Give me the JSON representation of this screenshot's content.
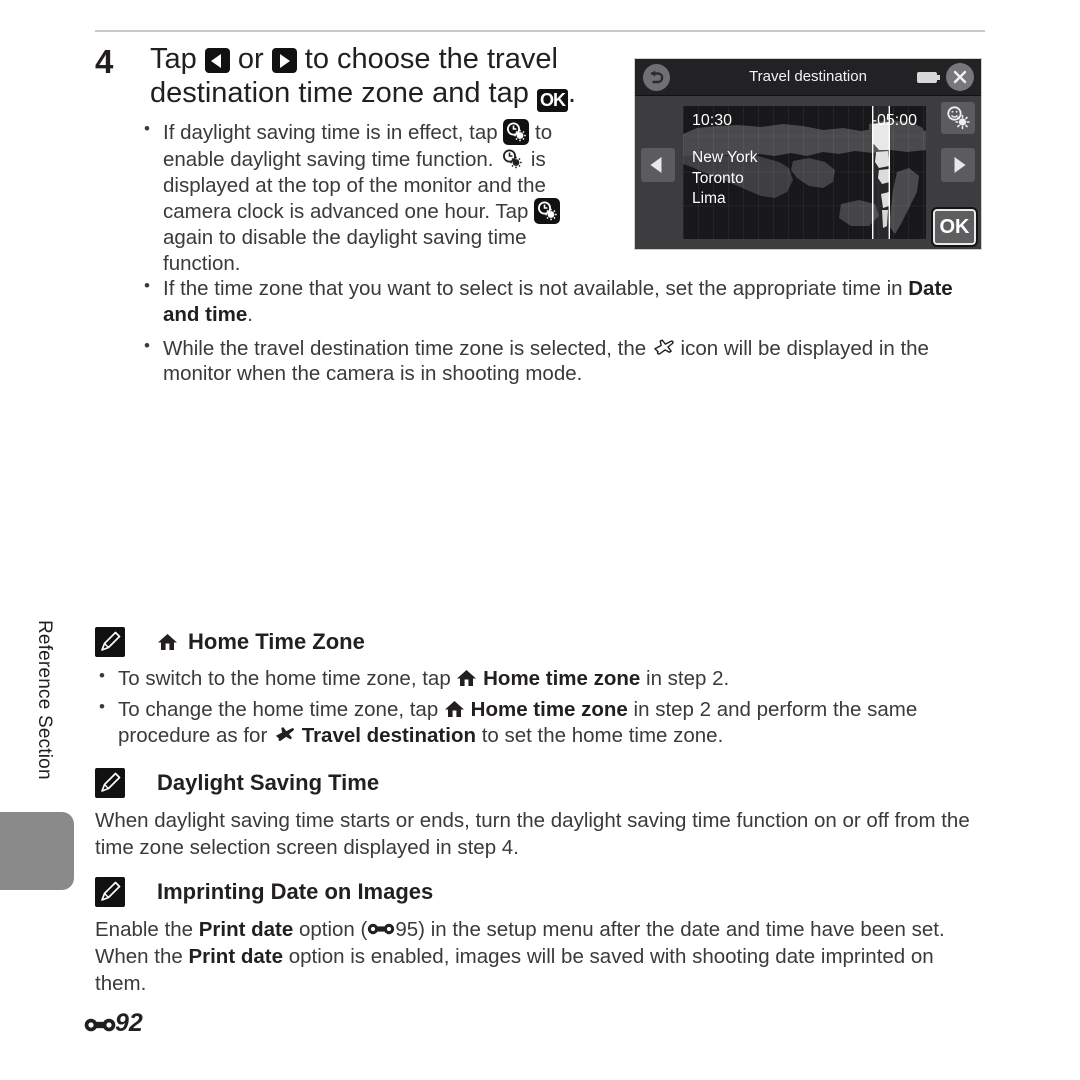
{
  "page": {
    "footer_marker_icon": "dumbbell-reference-icon",
    "footer_page_number": "92",
    "side_tab_label": "Reference Section"
  },
  "step": {
    "number": "4",
    "heading_part1": "Tap ",
    "heading_icon_left": "left-triangle-icon",
    "heading_or": " or ",
    "heading_icon_right": "right-triangle-icon",
    "heading_part2": " to choose the travel destination time zone and tap ",
    "heading_ok": "OK",
    "heading_end": ".",
    "bullets": [
      {
        "t1": "If daylight saving time is in effect, tap ",
        "icon1": "daylight-saving-inverse-icon",
        "t2": " to enable daylight saving time function. ",
        "icon2": "daylight-saving-icon",
        "t3": " is displayed at the top of the monitor and the camera clock is advanced one hour. Tap ",
        "icon3": "daylight-saving-inverse-icon",
        "t4": " again to disable the daylight saving time function."
      },
      {
        "t1": "If the time zone that you want to select is not available, set the appropriate time in ",
        "b1": "Date and time",
        "t2": "."
      },
      {
        "t1": "While the travel destination time zone is selected, the ",
        "icon1": "airplane-icon",
        "t2": " icon will be displayed in the monitor when the camera is in shooting mode."
      }
    ]
  },
  "screen": {
    "back_icon": "back-arrow-icon",
    "title": "Travel destination",
    "battery_icon": "battery-icon",
    "close_icon": "close-x-icon",
    "time": "10:30",
    "utc_offset": "-05:00",
    "cities": [
      "New York",
      "Toronto",
      "Lima"
    ],
    "prev_icon": "left-triangle-icon",
    "next_icon": "right-triangle-icon",
    "dst_icon": "daylight-saving-icon",
    "ok_label": "OK"
  },
  "notes": [
    {
      "id": "home-time-zone",
      "note_icon": "pencil-note-icon",
      "title_icon": "home-icon",
      "title": "Home Time Zone",
      "bullets": [
        {
          "t1": "To switch to the home time zone, tap ",
          "icon1": "home-icon",
          "b1": "Home time zone",
          "t2": " in step 2."
        },
        {
          "t1": "To change the home time zone, tap ",
          "icon1": "home-icon",
          "b1": "Home time zone",
          "t2": " in step 2 and perform the same procedure as for ",
          "icon2": "airplane-icon",
          "b2": "Travel destination",
          "t3": " to set the home time zone."
        }
      ]
    },
    {
      "id": "daylight-saving-time",
      "note_icon": "pencil-note-icon",
      "title": "Daylight Saving Time",
      "paragraph": "When daylight saving time starts or ends, turn the daylight saving time function on or off from the time zone selection screen displayed in step 4."
    },
    {
      "id": "imprinting-date-on-images",
      "note_icon": "pencil-note-icon",
      "title": "Imprinting Date on Images",
      "para_t1": "Enable the ",
      "para_b1": "Print date",
      "para_t2": " option (",
      "para_ref_icon": "dumbbell-reference-icon",
      "para_ref_page": "95",
      "para_t3": ") in the setup menu after the date and time have been set. When the ",
      "para_b2": "Print date",
      "para_t4": " option is enabled, images will be saved with shooting date imprinted on them."
    }
  ],
  "colors": {
    "text": "#3a3a3c",
    "heading": "#231f20",
    "tab_gray": "#8a8a8a",
    "screen_bg": "#3d3d3f",
    "screen_topbar": "#222224",
    "map_bg": "#18181a"
  }
}
